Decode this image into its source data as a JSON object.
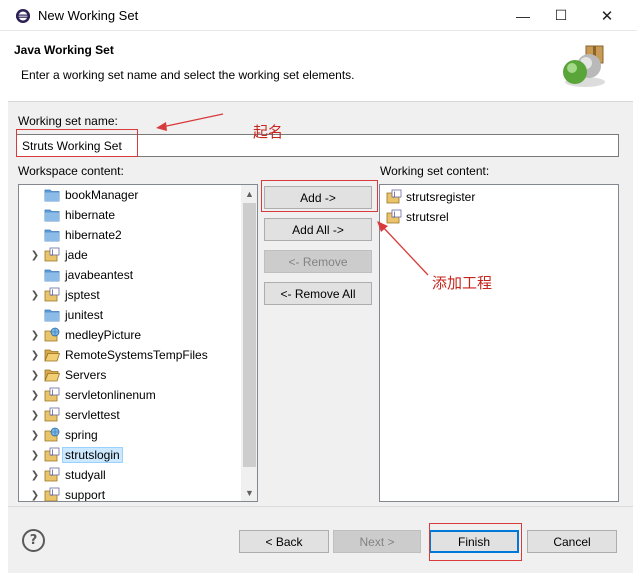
{
  "window": {
    "title": "New Working Set"
  },
  "header": {
    "title": "Java Working Set",
    "description": "Enter a working set name and select the working set elements."
  },
  "form": {
    "name_label": "Working set name:",
    "name_value": "Struts Working Set",
    "workspace_label": "Workspace content:",
    "set_label": "Working set content:"
  },
  "workspace_items": [
    {
      "label": "bookManager",
      "icon": "folder-icon",
      "expandable": false,
      "selected": false
    },
    {
      "label": "hibernate",
      "icon": "folder-icon",
      "expandable": false,
      "selected": false
    },
    {
      "label": "hibernate2",
      "icon": "folder-icon",
      "expandable": false,
      "selected": false
    },
    {
      "label": "jade",
      "icon": "java-project-icon",
      "expandable": true,
      "selected": false
    },
    {
      "label": "javabeantest",
      "icon": "folder-icon",
      "expandable": false,
      "selected": false
    },
    {
      "label": "jsptest",
      "icon": "java-project-icon",
      "expandable": true,
      "selected": false
    },
    {
      "label": "junitest",
      "icon": "folder-icon",
      "expandable": false,
      "selected": false
    },
    {
      "label": "medleyPicture",
      "icon": "web-project-icon",
      "expandable": true,
      "selected": false
    },
    {
      "label": "RemoteSystemsTempFiles",
      "icon": "open-folder-icon",
      "expandable": true,
      "selected": false
    },
    {
      "label": "Servers",
      "icon": "open-folder-icon",
      "expandable": true,
      "selected": false
    },
    {
      "label": "servletonlinenum",
      "icon": "java-project-icon",
      "expandable": true,
      "selected": false
    },
    {
      "label": "servlettest",
      "icon": "java-project-icon",
      "expandable": true,
      "selected": false
    },
    {
      "label": "spring",
      "icon": "web-project-icon",
      "expandable": true,
      "selected": false
    },
    {
      "label": "strutslogin",
      "icon": "java-project-icon",
      "expandable": true,
      "selected": true
    },
    {
      "label": "studyall",
      "icon": "java-project-icon",
      "expandable": true,
      "selected": false
    },
    {
      "label": "support",
      "icon": "java-project-icon",
      "expandable": true,
      "selected": false
    }
  ],
  "set_items": [
    {
      "label": "strutsregister",
      "icon": "java-project-icon"
    },
    {
      "label": "strutsrel",
      "icon": "java-project-icon"
    }
  ],
  "buttons": {
    "add": "Add ->",
    "add_all": "Add All ->",
    "remove": "<- Remove",
    "remove_all": "<- Remove All",
    "back": "< Back",
    "next": "Next >",
    "finish": "Finish",
    "cancel": "Cancel"
  },
  "annotations": {
    "name_note": "起名",
    "add_note": "添加工程"
  },
  "colors": {
    "annotation_red": "#d83b3b",
    "selection_blue": "#cce8ff",
    "default_button_border": "#0078d7"
  }
}
